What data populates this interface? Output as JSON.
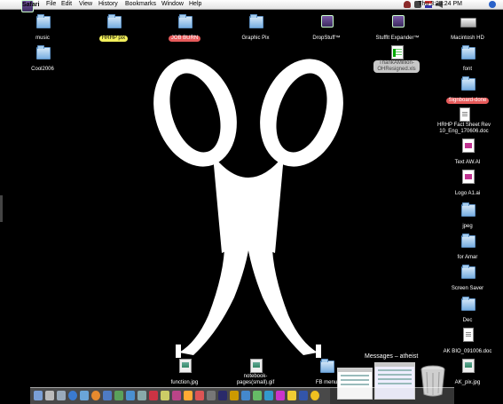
{
  "menubar": {
    "apple_glyph": "",
    "app_name": "Safari",
    "menus": [
      "File",
      "Edit",
      "View",
      "History",
      "Bookmarks",
      "Window",
      "Help"
    ],
    "clock": "Thu 3:25:24 PM",
    "status_icons": [
      "user-icon",
      "bluetooth-icon",
      "flag-icon",
      "volume-icon"
    ]
  },
  "desktop_icons": [
    {
      "name": "music",
      "type": "folder"
    },
    {
      "name": "HRHP pix",
      "type": "folder",
      "label_color": "yellow"
    },
    {
      "name": "JOB BURN",
      "type": "folder",
      "label_color": "red"
    },
    {
      "name": "Graphic Pix",
      "type": "folder"
    },
    {
      "name": "DropStuff™",
      "type": "app"
    },
    {
      "name": "StuffIt Expander™",
      "type": "app"
    },
    {
      "name": "Macintosh HD",
      "type": "drive"
    },
    {
      "name": "Cool2006",
      "type": "folder"
    },
    {
      "name": "ThankAMillion-OHResigned.xls",
      "type": "xls",
      "label_color": "grey"
    },
    {
      "name": "font",
      "type": "folder"
    },
    {
      "name": "Signboard-done",
      "type": "folder",
      "label_color": "red"
    },
    {
      "name": "HRHP Fact Sheet Rev 10_Eng_170606.doc",
      "type": "doc"
    },
    {
      "name": "Text AW.AI",
      "type": "ai"
    },
    {
      "name": "Logo A1.ai",
      "type": "ai"
    },
    {
      "name": "jpeg",
      "type": "folder"
    },
    {
      "name": "for Amar",
      "type": "folder"
    },
    {
      "name": "Screen Saver",
      "type": "folder"
    },
    {
      "name": "Dec",
      "type": "folder"
    },
    {
      "name": "AK BIO_091006.doc",
      "type": "doc"
    },
    {
      "name": "function.jpg",
      "type": "jpg"
    },
    {
      "name": "notebook-pages(small).gif",
      "type": "jpg"
    },
    {
      "name": "FB menu",
      "type": "folder"
    },
    {
      "name": "AK_pix.jpg",
      "type": "jpg"
    }
  ],
  "messages_window": {
    "title": "Messages – atheist"
  }
}
